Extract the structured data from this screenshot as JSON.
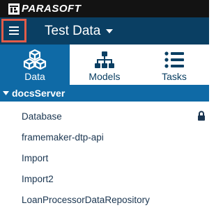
{
  "brand": {
    "name": "PARASOFT"
  },
  "appbar": {
    "title": "Test Data",
    "menu_icon": "hamburger-icon"
  },
  "tabs": [
    {
      "label": "Data",
      "icon": "cubes-icon",
      "active": true
    },
    {
      "label": "Models",
      "icon": "hierarchy-icon",
      "active": false
    },
    {
      "label": "Tasks",
      "icon": "task-list-icon",
      "active": false
    }
  ],
  "server": {
    "name": "docsServer"
  },
  "repositories": [
    {
      "name": "Database",
      "locked": true
    },
    {
      "name": "framemaker-dtp-api",
      "locked": false
    },
    {
      "name": "Import",
      "locked": false
    },
    {
      "name": "Import2",
      "locked": false
    },
    {
      "name": "LoanProcessorDataRepository",
      "locked": false
    }
  ],
  "colors": {
    "brand_bar": "#131313",
    "app_bar": "#0a3f63",
    "accent_blue": "#0f6aa6",
    "highlight": "#e25c49"
  }
}
